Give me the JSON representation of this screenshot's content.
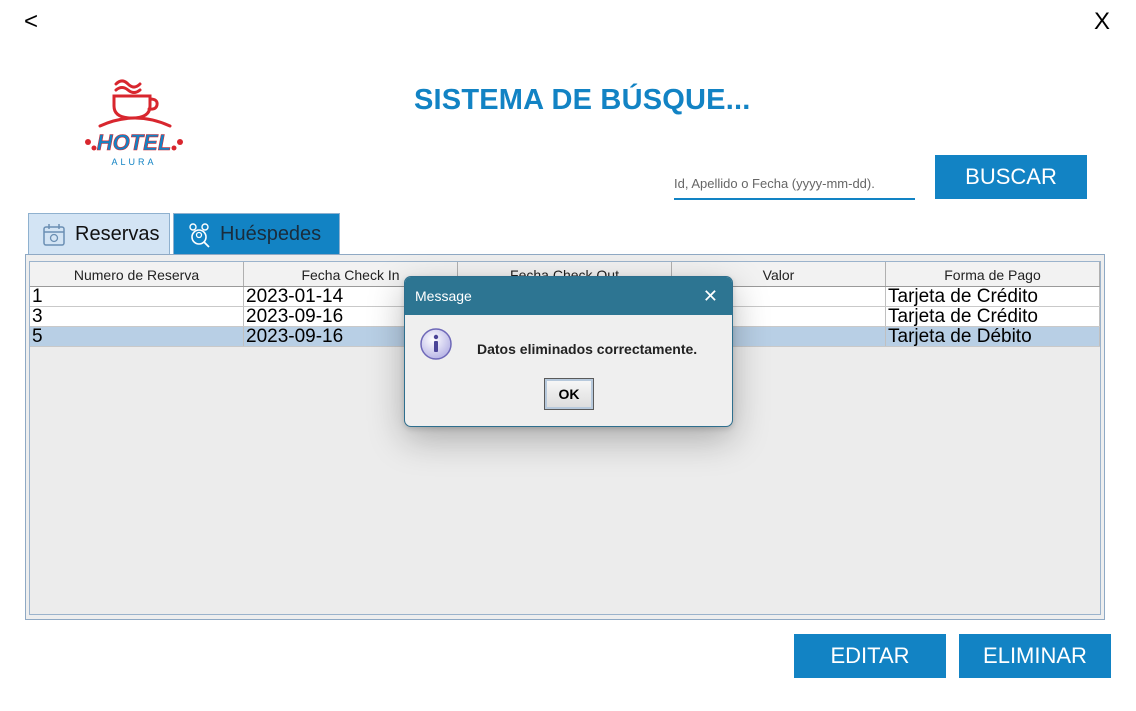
{
  "window": {
    "back_label": "<",
    "close_label": "X"
  },
  "logo": {
    "name": "HOTEL",
    "sub": "ALURA"
  },
  "title": "SISTEMA DE BÚSQUE...",
  "search": {
    "placeholder": "Id, Apellido o Fecha (yyyy-mm-dd).",
    "value": "",
    "button_label": "BUSCAR"
  },
  "tabs": [
    {
      "label": "Reservas",
      "icon": "calendar-icon"
    },
    {
      "label": "Huéspedes",
      "icon": "guests-search-icon"
    }
  ],
  "table": {
    "columns": [
      "Numero de Reserva",
      "Fecha Check In",
      "Fecha Check Out",
      "Valor",
      "Forma de Pago"
    ],
    "rows": [
      [
        "1",
        "2023-01-14",
        "",
        "",
        "Tarjeta de Crédito"
      ],
      [
        "3",
        "2023-09-16",
        "",
        "",
        "Tarjeta de Crédito"
      ],
      [
        "5",
        "2023-09-16",
        "",
        "",
        "Tarjeta de Débito"
      ]
    ],
    "selected_row": 2
  },
  "buttons": {
    "edit_label": "EDITAR",
    "delete_label": "ELIMINAR"
  },
  "dialog": {
    "title": "Message",
    "close_label": "✕",
    "message": "Datos eliminados correctamente.",
    "ok_label": "OK",
    "icon": "info-icon"
  },
  "colors": {
    "accent": "#1283c4",
    "dialog_titlebar": "#2d7592",
    "selection": "#b8cfe5",
    "logo_red": "#d8262e"
  }
}
